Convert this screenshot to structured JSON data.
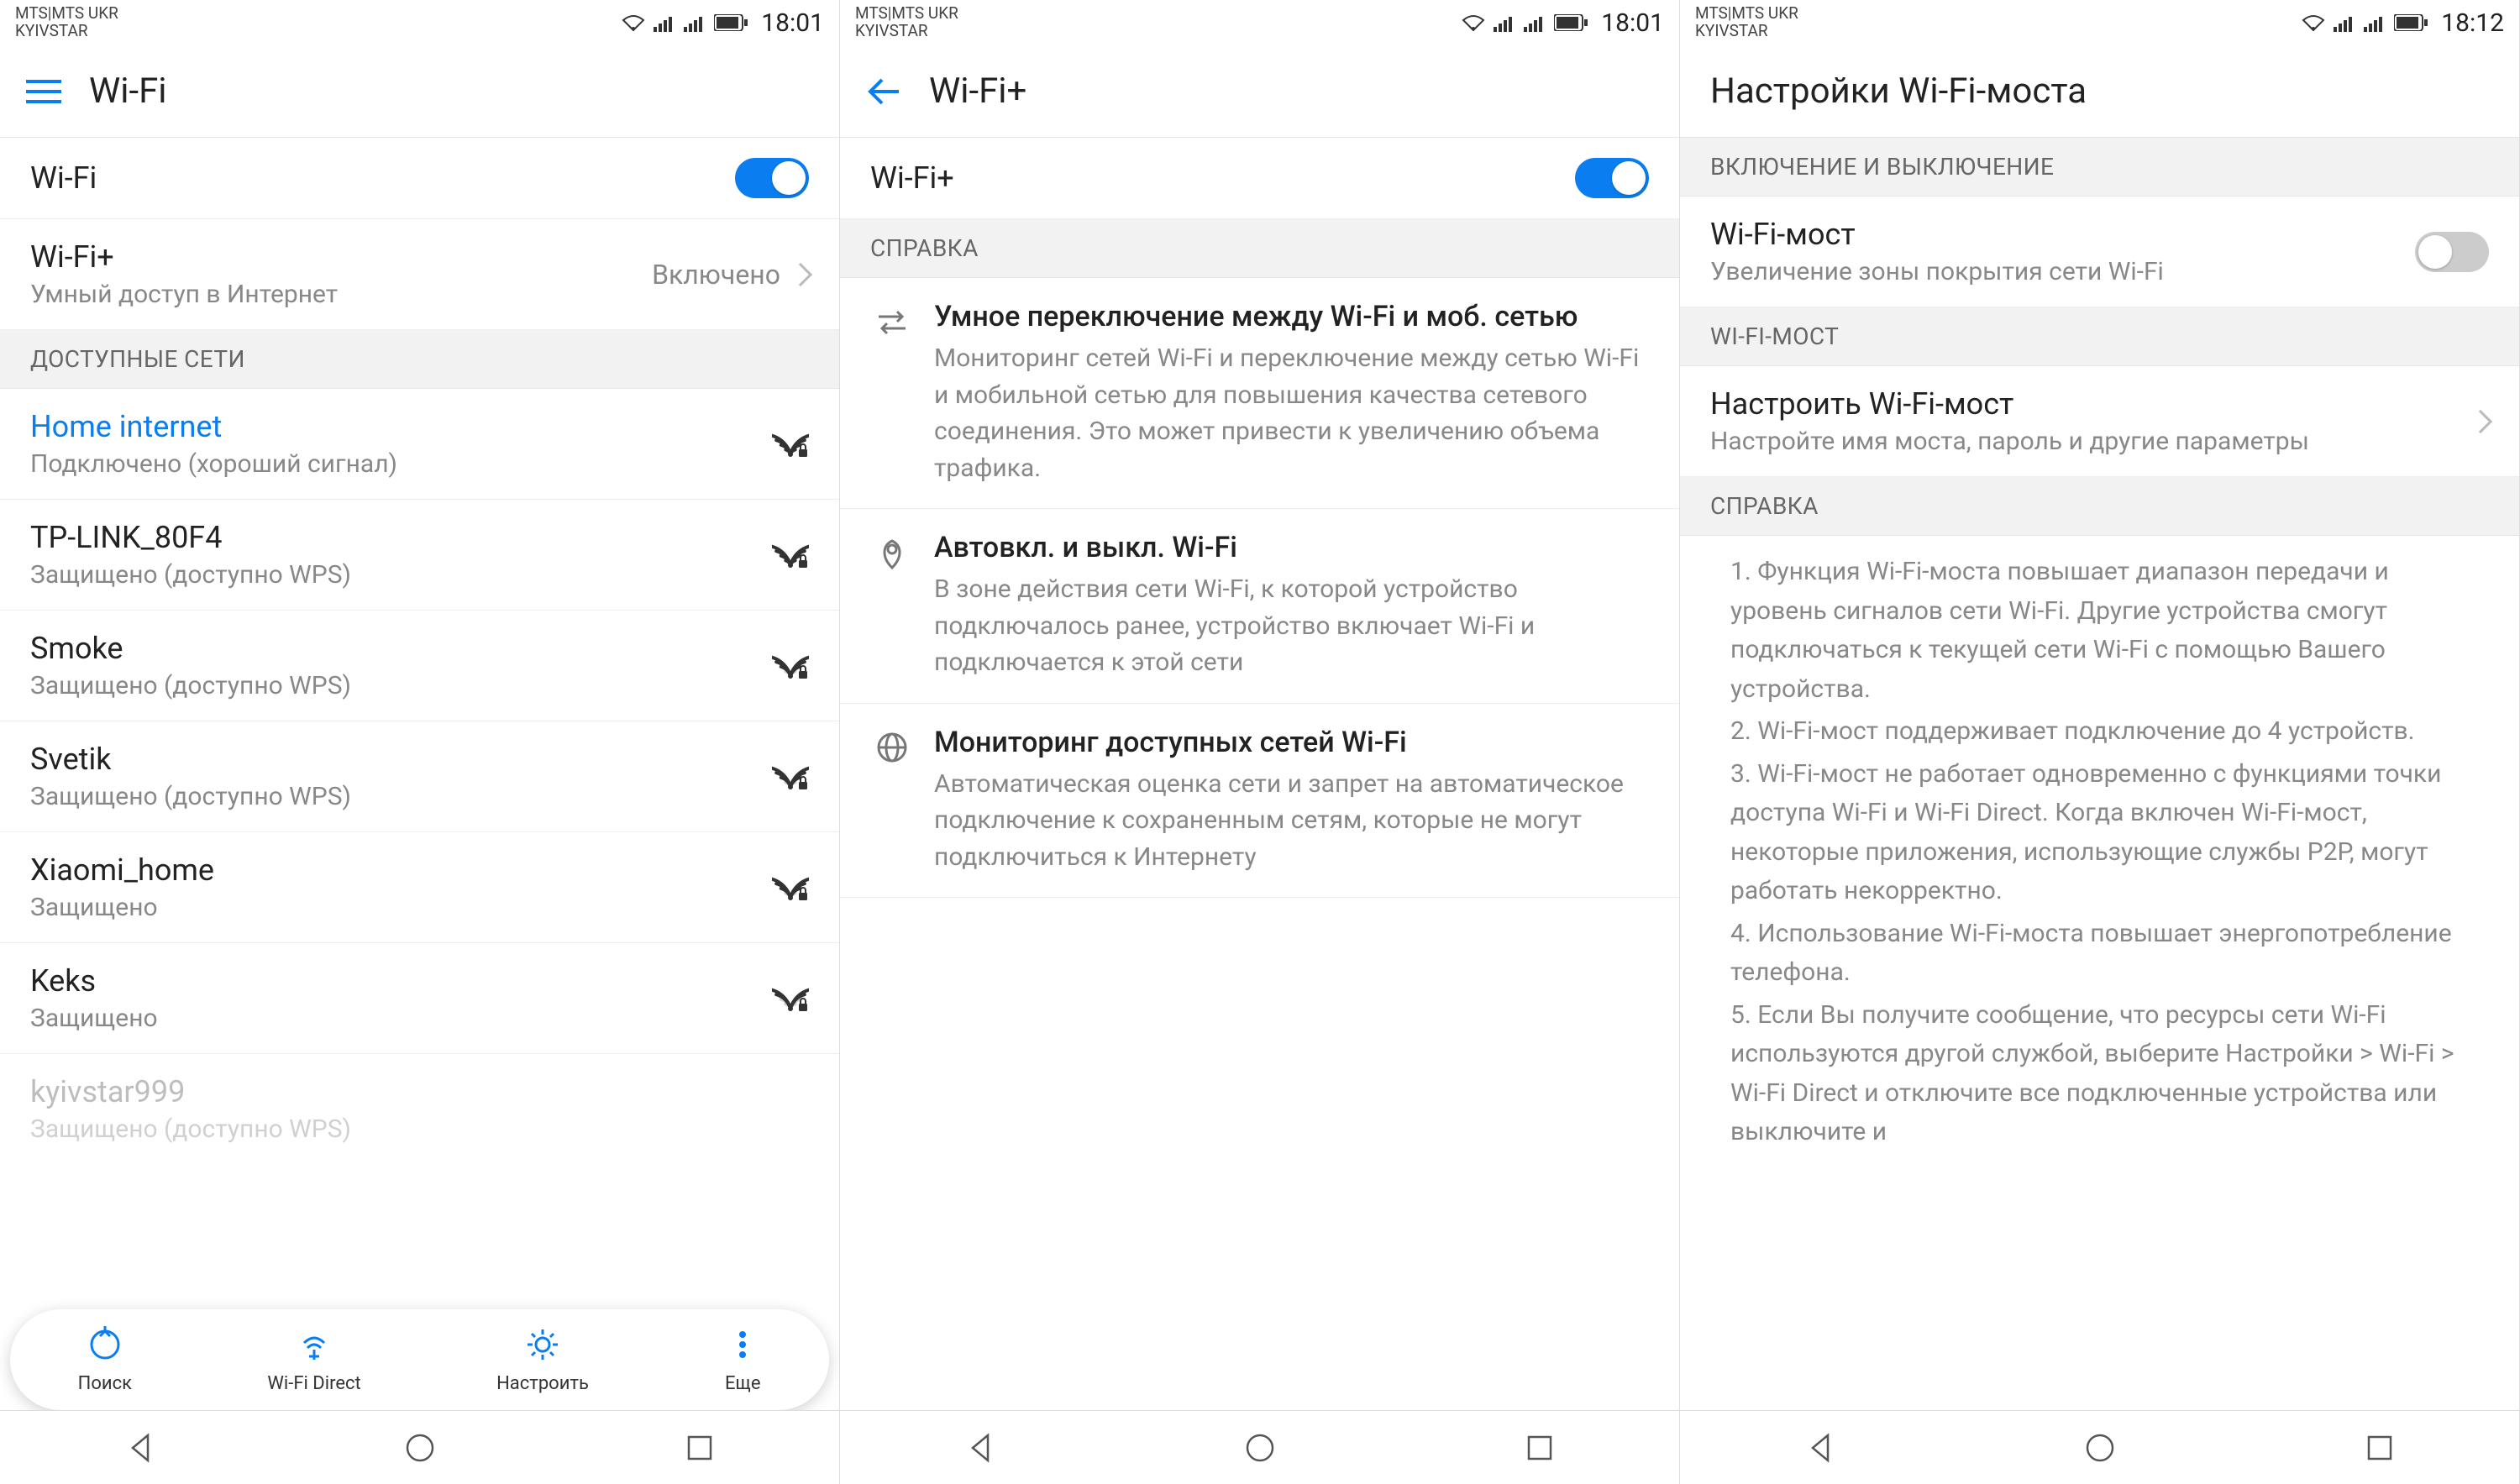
{
  "status": {
    "carrier_line1": "MTS|MTS UKR",
    "carrier_line2": "KYIVSTAR",
    "time1": "18:01",
    "time2": "18:01",
    "time3": "18:12"
  },
  "screen1": {
    "title": "Wi-Fi",
    "wifi_label": "Wi-Fi",
    "wifi_plus_title": "Wi-Fi+",
    "wifi_plus_sub": "Умный доступ в Интернет",
    "wifi_plus_status": "Включено",
    "available_header": "ДОСТУПНЫЕ СЕТИ",
    "networks": [
      {
        "name": "Home internet",
        "sub": "Подключено (хороший сигнал)",
        "connected": true,
        "signal": 4,
        "lock": true
      },
      {
        "name": "TP-LINK_80F4",
        "sub": "Защищено (доступно WPS)",
        "connected": false,
        "signal": 4,
        "lock": true
      },
      {
        "name": "Smoke",
        "sub": "Защищено (доступно WPS)",
        "connected": false,
        "signal": 3,
        "lock": true
      },
      {
        "name": "Svetik",
        "sub": "Защищено (доступно WPS)",
        "connected": false,
        "signal": 3,
        "lock": true
      },
      {
        "name": "Xiaomi_home",
        "sub": "Защищено",
        "connected": false,
        "signal": 3,
        "lock": true
      },
      {
        "name": "Keks",
        "sub": "Защищено",
        "connected": false,
        "signal": 2,
        "lock": true
      }
    ],
    "faded_name": "kyivstar999",
    "faded_sub": "Защищено (доступно WPS)",
    "actions": {
      "search": "Поиск",
      "direct": "Wi-Fi Direct",
      "configure": "Настроить",
      "more": "Еще"
    }
  },
  "screen2": {
    "title": "Wi-Fi+",
    "wifi_plus_label": "Wi-Fi+",
    "help_header": "СПРАВКА",
    "items": [
      {
        "icon": "swap",
        "title": "Умное переключение между Wi-Fi и моб. сетью",
        "body": "Мониторинг сетей Wi-Fi и переключение между сетью Wi-Fi и мобильной сетью для повышения качества сетевого соединения. Это может привести к увеличению объема трафика."
      },
      {
        "icon": "pin",
        "title": "Автовкл. и выкл. Wi-Fi",
        "body": "В зоне действия сети Wi-Fi, к которой устройство подключалось ранее, устройство включает Wi-Fi и подключается к этой сети"
      },
      {
        "icon": "globe",
        "title": "Мониторинг доступных сетей Wi-Fi",
        "body": "Автоматическая оценка сети и запрет на автоматическое подключение к сохраненным сетям, которые не могут подключиться к Интернету"
      }
    ]
  },
  "screen3": {
    "title": "Настройки Wi-Fi-моста",
    "section_toggle": "ВКЛЮЧЕНИЕ И ВЫКЛЮЧЕНИЕ",
    "bridge_title": "Wi-Fi-мост",
    "bridge_sub": "Увеличение зоны покрытия сети Wi-Fi",
    "section_bridge": "WI-FI-МОСТ",
    "configure_title": "Настроить Wi-Fi-мост",
    "configure_sub": "Настройте имя моста, пароль и другие параметры",
    "section_help": "СПРАВКА",
    "help_points": [
      "1. Функция Wi-Fi-моста повышает диапазон передачи и уровень сигналов сети Wi-Fi. Другие устройства смогут подключаться к текущей сети Wi-Fi с помощью Вашего устройства.",
      "2. Wi-Fi-мост поддерживает подключение до 4 устройств.",
      "3. Wi-Fi-мост не работает одновременно с функциями точки доступа Wi-Fi и Wi-Fi Direct. Когда включен Wi-Fi-мост, некоторые приложения, использующие службы P2P, могут работать некорректно.",
      "4. Использование Wi-Fi-моста повышает энергопотребление телефона.",
      "5. Если Вы получите сообщение, что ресурсы сети Wi-Fi используются другой службой, выберите Настройки > Wi-Fi > Wi-Fi Direct и отключите все подключенные устройства или выключите и"
    ]
  }
}
